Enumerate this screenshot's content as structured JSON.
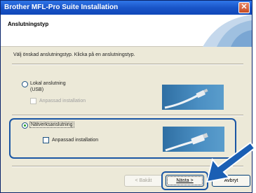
{
  "window": {
    "title": "Brother MFL-Pro Suite Installation",
    "close_glyph": "✕"
  },
  "header": {
    "title": "Anslutningstyp"
  },
  "content": {
    "instruction": "Välj önskad anslutningstyp. Klicka på en anslutningstyp.",
    "options": [
      {
        "label": "Lokal anslutning",
        "sublabel": "(USB)",
        "checked": false,
        "custom_install_label": "Anpassad installation",
        "custom_install_enabled": false,
        "icon": "usb-cable-icon"
      },
      {
        "label": "Nätverksanslutning",
        "checked": true,
        "custom_install_label": "Anpassad installation",
        "custom_install_enabled": true,
        "icon": "network-cable-icon"
      }
    ]
  },
  "buttons": {
    "back": "< Bakåt",
    "next": "Nästa >",
    "cancel": "Avbryt"
  },
  "colors": {
    "titlebar": "#1a55c8",
    "highlight": "#1a56a4",
    "arrow": "#1a5fb4"
  }
}
